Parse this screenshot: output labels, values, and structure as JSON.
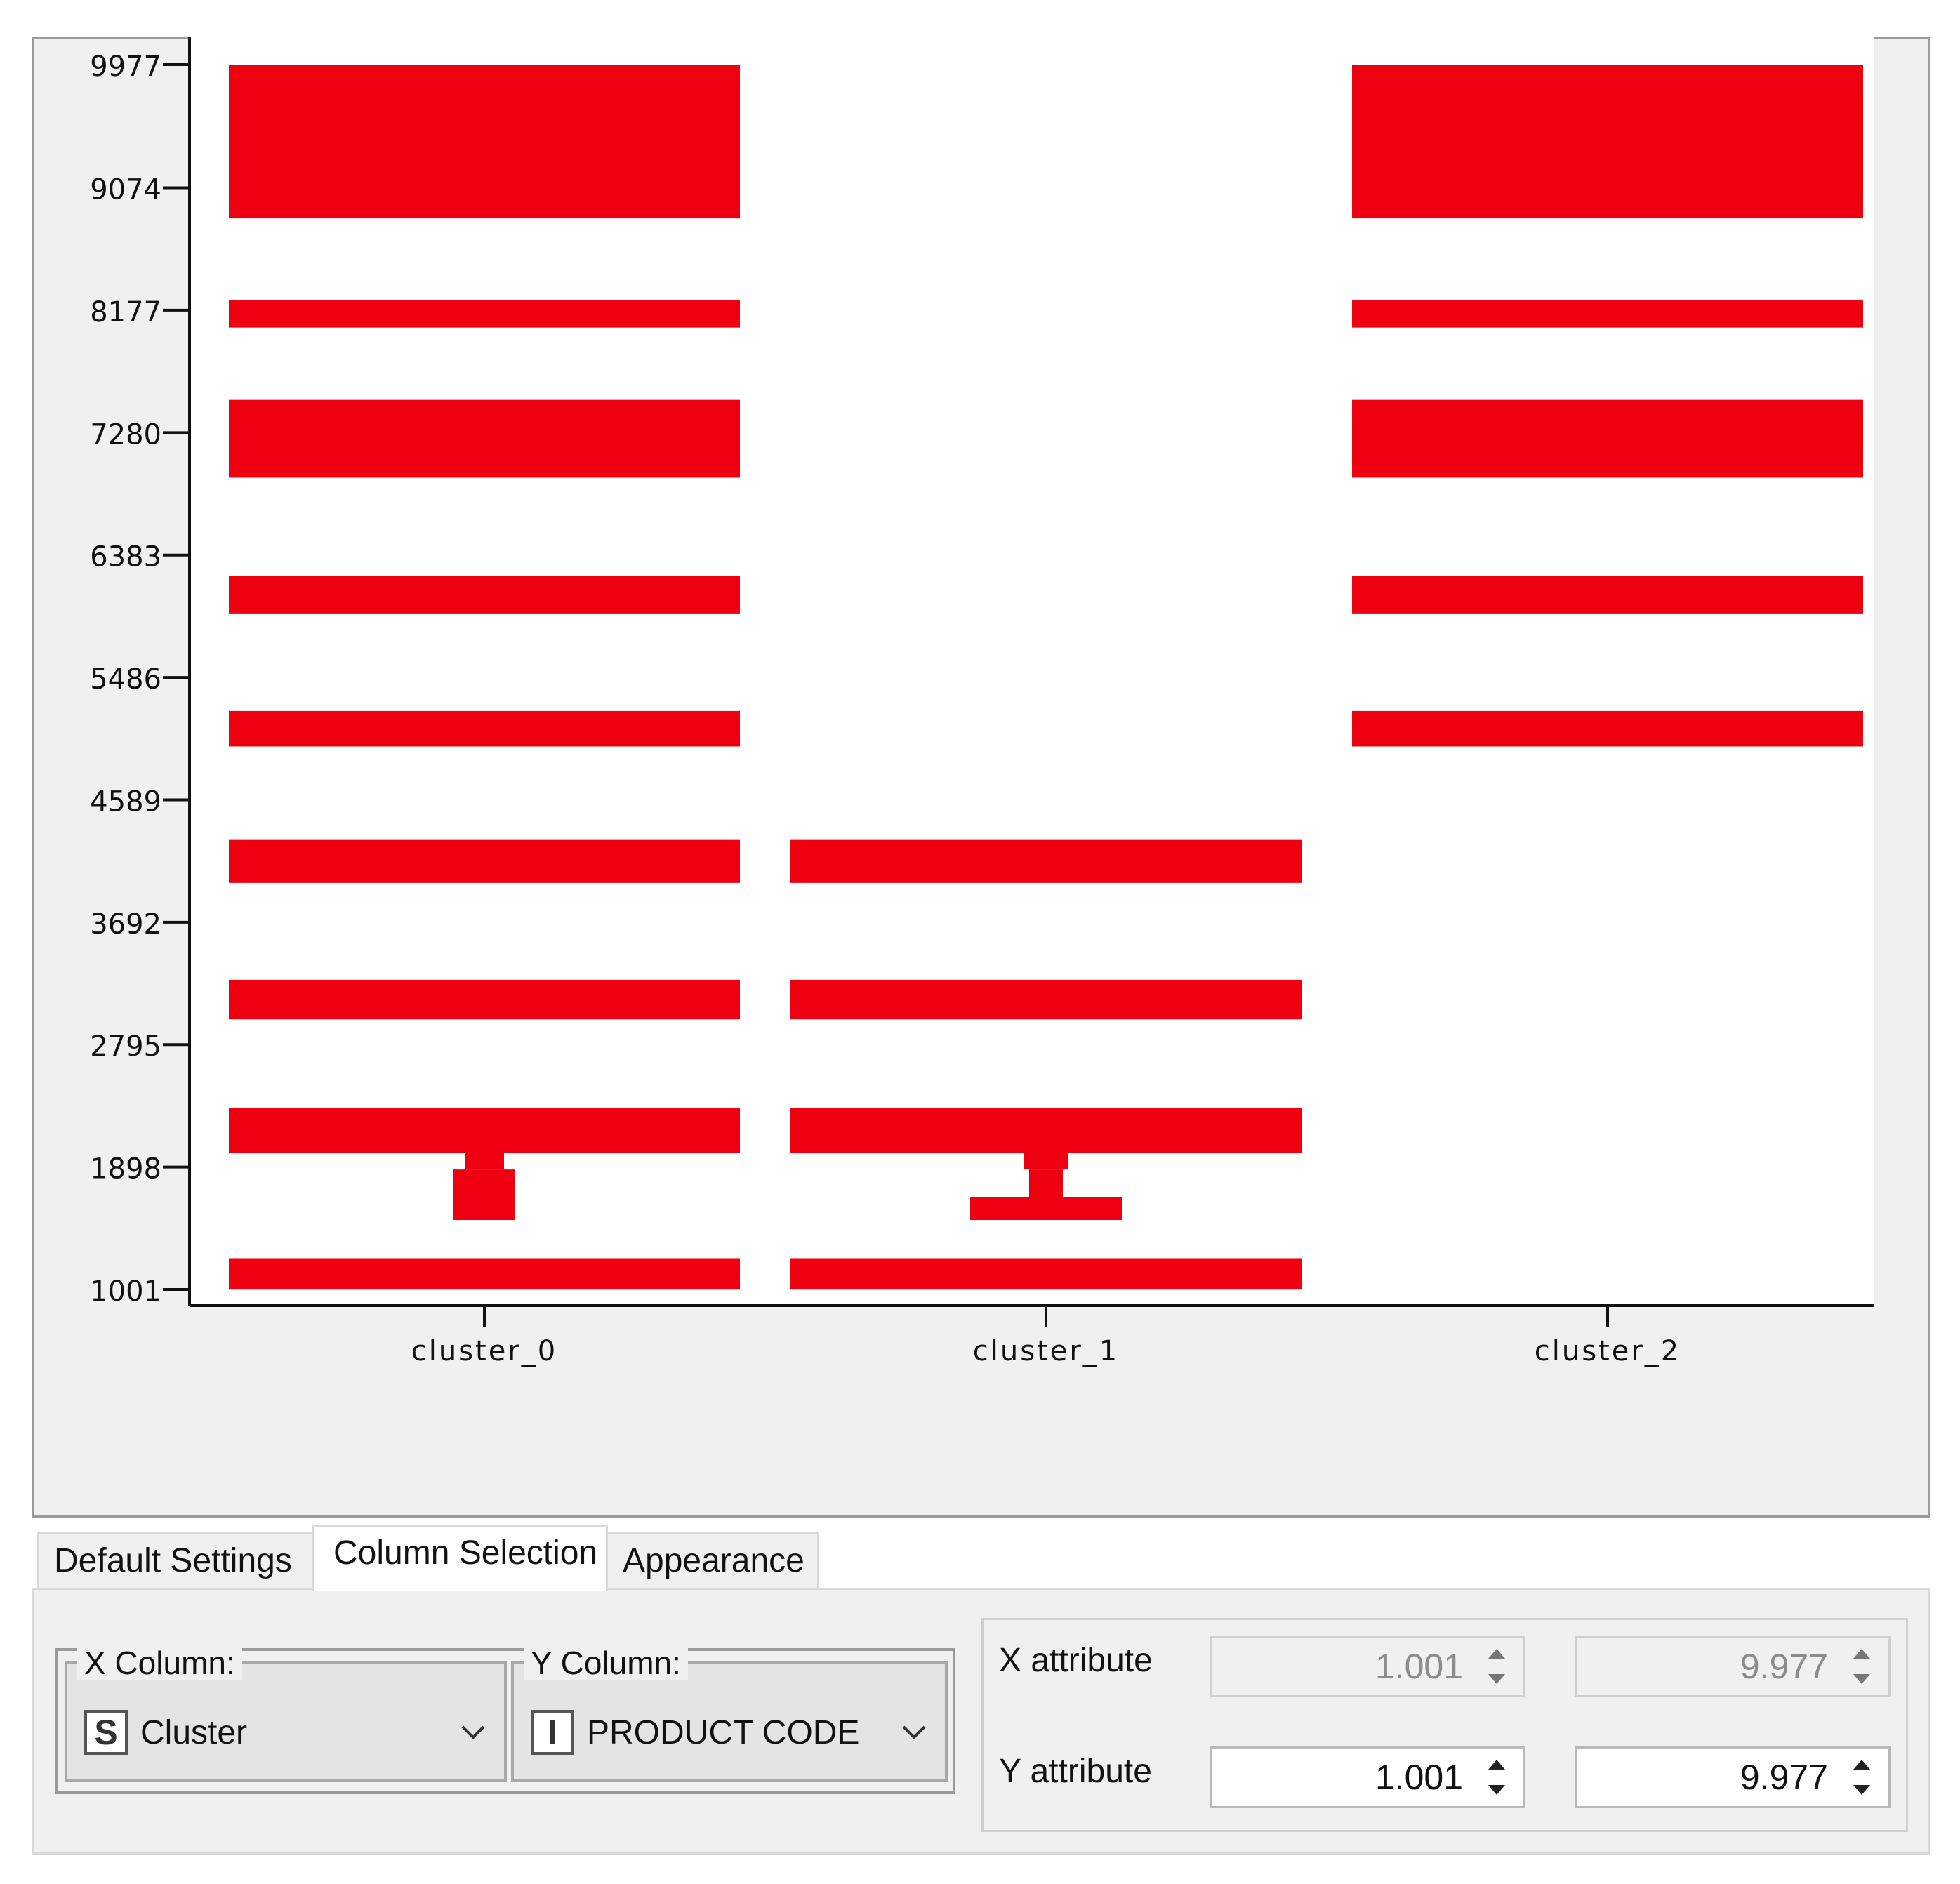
{
  "chart_data": {
    "type": "bar",
    "categories": [
      "cluster_0",
      "cluster_1",
      "cluster_2"
    ],
    "y_ticks": [
      9977,
      9074,
      8177,
      7280,
      6383,
      5486,
      4589,
      3692,
      2795,
      1898,
      1001
    ],
    "ylim": [
      1001,
      9977
    ],
    "grid": false,
    "bar_color": "#ee0011",
    "segments": [
      {
        "category": "cluster_0",
        "y0": 8850,
        "y1": 9977
      },
      {
        "category": "cluster_0",
        "y0": 8050,
        "y1": 8250
      },
      {
        "category": "cluster_0",
        "y0": 6950,
        "y1": 7520
      },
      {
        "category": "cluster_0",
        "y0": 5950,
        "y1": 6230
      },
      {
        "category": "cluster_0",
        "y0": 4980,
        "y1": 5240
      },
      {
        "category": "cluster_0",
        "y0": 3980,
        "y1": 4300
      },
      {
        "category": "cluster_0",
        "y0": 2980,
        "y1": 3270
      },
      {
        "category": "cluster_0",
        "y0": 2000,
        "y1": 2330
      },
      {
        "category": "cluster_0",
        "y0": 1510,
        "y1": 1880,
        "width": 0.11
      },
      {
        "category": "cluster_0",
        "y0": 1880,
        "y1": 2000,
        "width": 0.07
      },
      {
        "category": "cluster_0",
        "y0": 1000,
        "y1": 1230
      },
      {
        "category": "cluster_1",
        "y0": 3980,
        "y1": 4300
      },
      {
        "category": "cluster_1",
        "y0": 2980,
        "y1": 3270
      },
      {
        "category": "cluster_1",
        "y0": 2000,
        "y1": 2330
      },
      {
        "category": "cluster_1",
        "y0": 1880,
        "y1": 2000,
        "width": 0.08
      },
      {
        "category": "cluster_1",
        "y0": 1680,
        "y1": 1880,
        "width": 0.06
      },
      {
        "category": "cluster_1",
        "y0": 1510,
        "y1": 1680,
        "width": 0.27
      },
      {
        "category": "cluster_1",
        "y0": 1000,
        "y1": 1230
      },
      {
        "category": "cluster_2",
        "y0": 8850,
        "y1": 9977
      },
      {
        "category": "cluster_2",
        "y0": 8050,
        "y1": 8250
      },
      {
        "category": "cluster_2",
        "y0": 6950,
        "y1": 7520
      },
      {
        "category": "cluster_2",
        "y0": 5950,
        "y1": 6230
      },
      {
        "category": "cluster_2",
        "y0": 4980,
        "y1": 5240
      }
    ]
  },
  "tabs": [
    {
      "label": "Default Settings"
    },
    {
      "label": "Column Selection"
    },
    {
      "label": "Appearance"
    }
  ],
  "active_tab": "Column Selection",
  "x_column": {
    "legend": "X Column:",
    "type_icon": "S",
    "value": "Cluster"
  },
  "y_column": {
    "legend": "Y Column:",
    "type_icon": "I",
    "value": "PRODUCT CODE"
  },
  "x_attribute": {
    "label": "X attribute",
    "min": "1.001",
    "max": "9.977",
    "enabled": false
  },
  "y_attribute": {
    "label": "Y attribute",
    "min": "1.001",
    "max": "9.977",
    "enabled": true
  }
}
